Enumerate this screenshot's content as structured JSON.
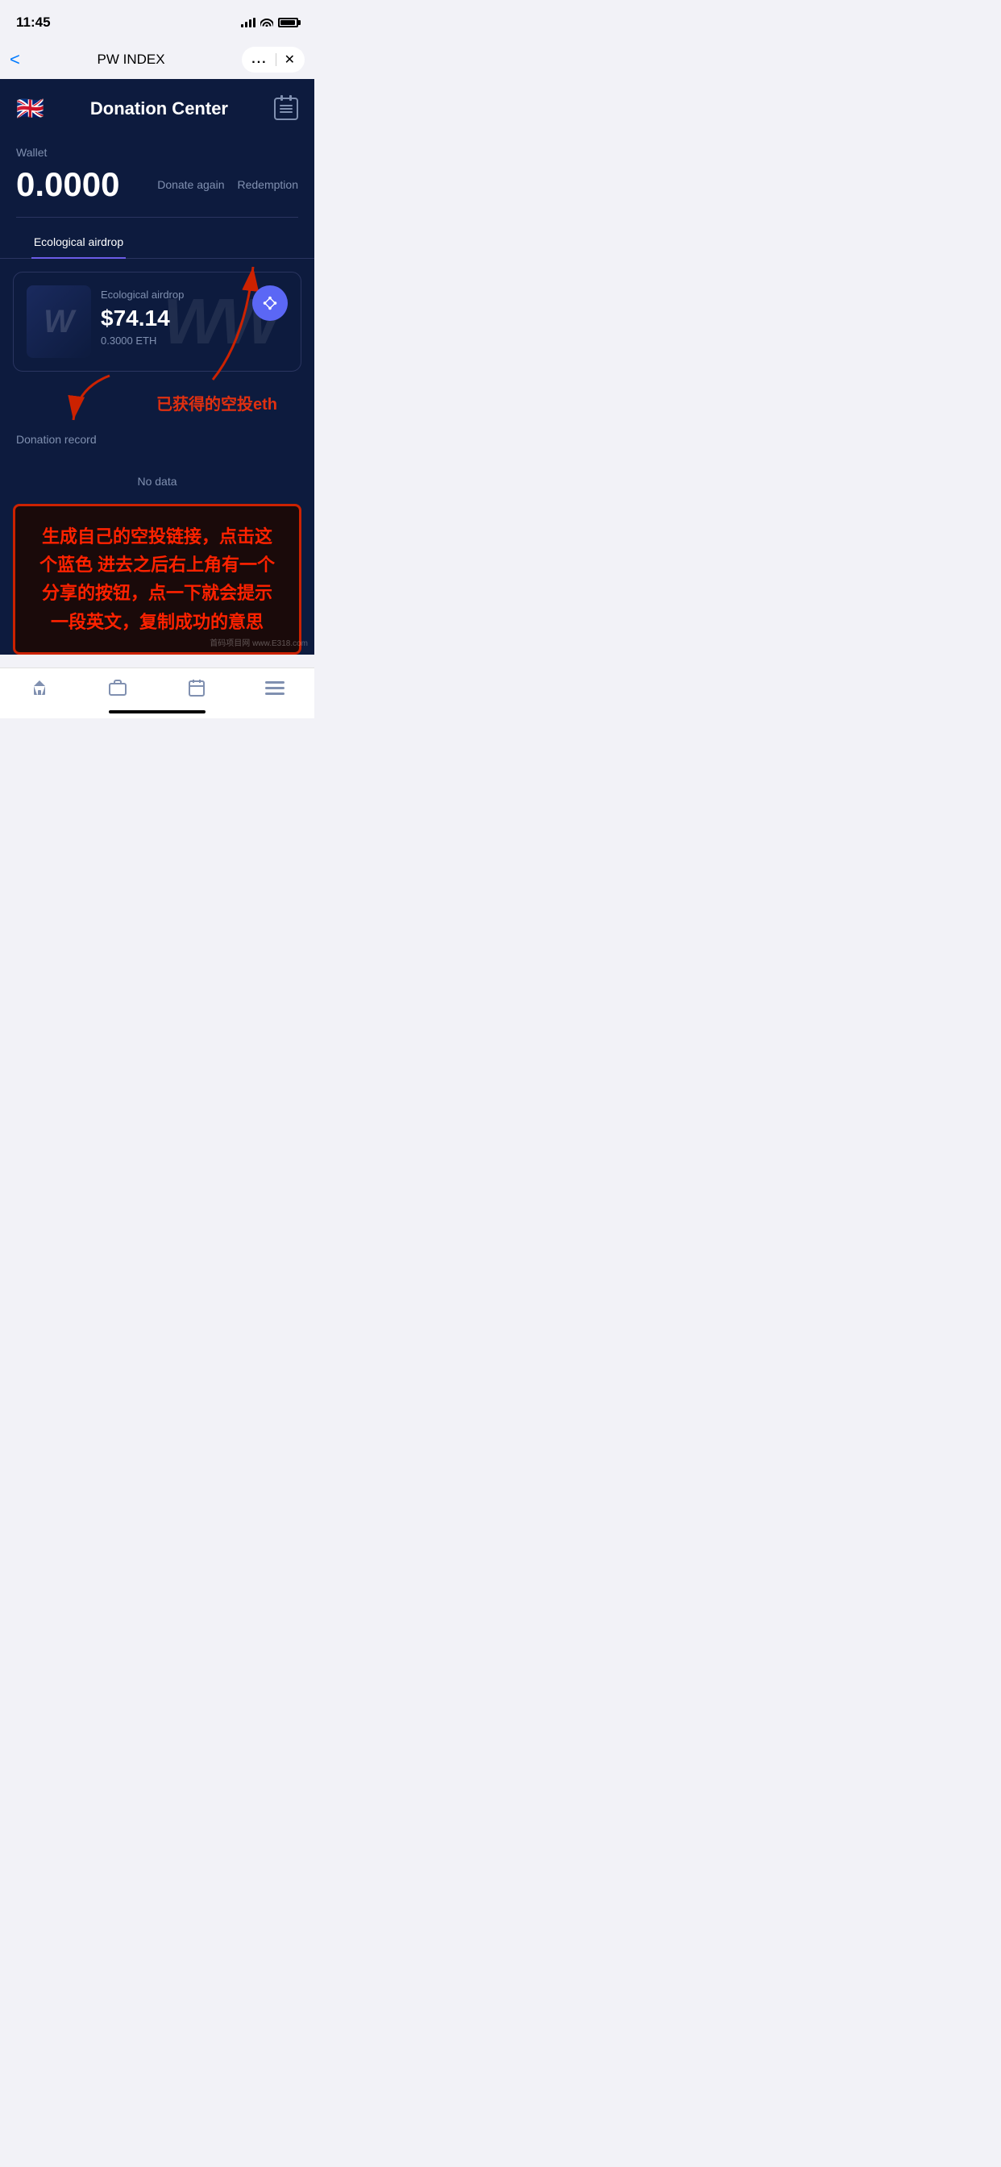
{
  "statusBar": {
    "time": "11:45",
    "signal": "4 bars",
    "wifi": true,
    "battery": "full"
  },
  "browserBar": {
    "backLabel": "<",
    "title": "PW INDEX",
    "dotsLabel": "...",
    "closeLabel": "✕"
  },
  "header": {
    "flag": "🇬🇧",
    "title": "Donation Center",
    "calendarIconLabel": "calendar"
  },
  "wallet": {
    "label": "Wallet",
    "balance": "0.0000",
    "donateAgainLabel": "Donate again",
    "redemptionLabel": "Redemption"
  },
  "tabs": [
    {
      "label": "Ecological airdrop",
      "active": true
    },
    {
      "label": "",
      "active": false
    }
  ],
  "airdropCard": {
    "subtitle": "Ecological airdrop",
    "amount": "$74.14",
    "ethAmount": "0.3000 ETH",
    "shareIconLabel": "share-network-icon"
  },
  "donationSection": {
    "label": "Donation record",
    "noDataLabel": "No data"
  },
  "redLabel": "已获得的空投eth",
  "annotationBox": {
    "text": "生成自己的空投链接，点击这个蓝色 进去之后右上角有一个分享的按钮，点一下就会提示一段英文，复制成功的意思"
  },
  "bottomNav": {
    "homeIcon": "🏠",
    "briefcaseIcon": "💼",
    "calendarIcon": "📅",
    "menuIcon": "☰"
  },
  "watermark": "首码项目网 www.E318.com"
}
